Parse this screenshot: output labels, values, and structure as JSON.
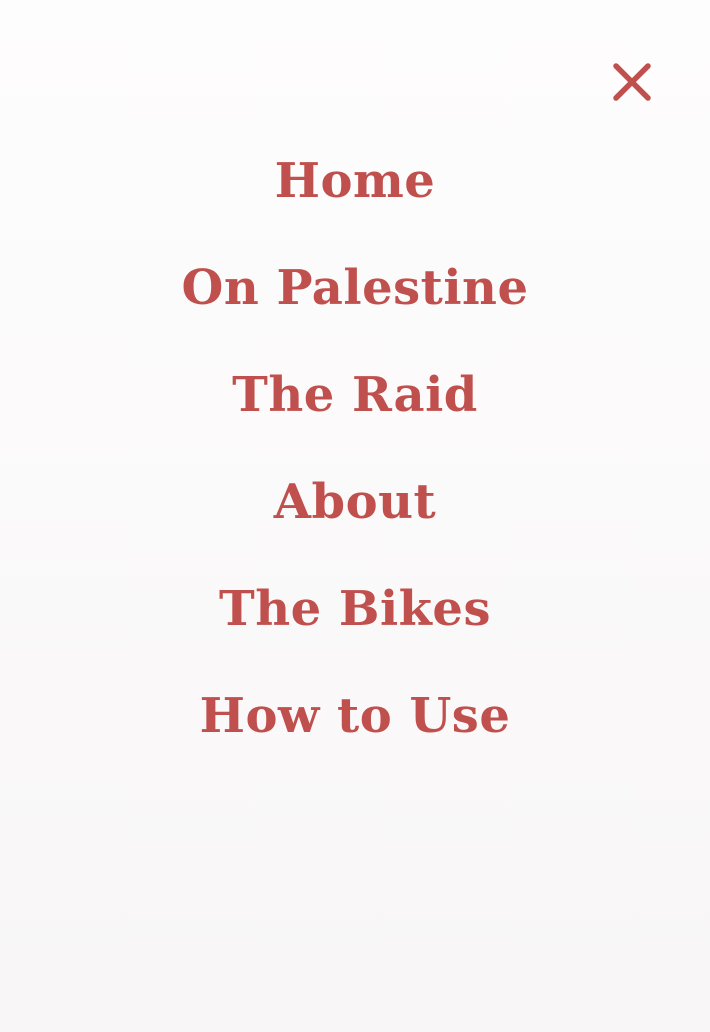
{
  "colors": {
    "accent": "#c0504d",
    "background_top": "#fefdfd",
    "background_bottom": "#f8f6f6"
  },
  "close": {
    "icon": "close-icon"
  },
  "nav": {
    "items": [
      {
        "label": "Home"
      },
      {
        "label": "On Palestine"
      },
      {
        "label": "The Raid"
      },
      {
        "label": "About"
      },
      {
        "label": "The Bikes"
      },
      {
        "label": "How to Use"
      }
    ]
  }
}
